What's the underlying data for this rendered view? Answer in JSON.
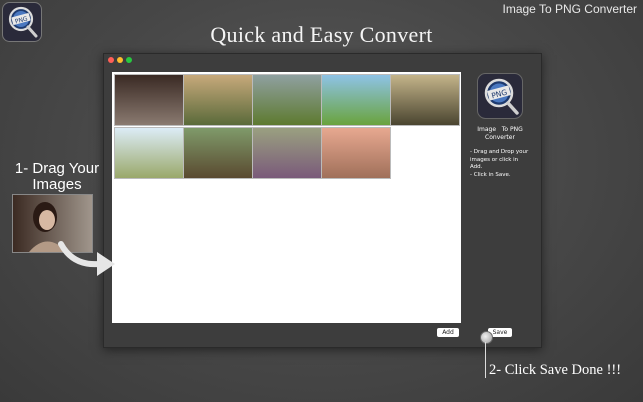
{
  "app_title": "Image To PNG Converter",
  "app_icon": "png-magnifier-icon",
  "headline": "Quick and Easy Convert",
  "window": {
    "traffic_lights": [
      "close",
      "minimize",
      "zoom"
    ],
    "thumbnails": [
      {
        "name": "woman-portrait",
        "top": "#3a2a24",
        "bottom": "#8a7a70"
      },
      {
        "name": "girl-on-hill",
        "top": "#c7a97b",
        "bottom": "#5a6a3a"
      },
      {
        "name": "child-in-field",
        "top": "#8fa0a0",
        "bottom": "#5e7a2f"
      },
      {
        "name": "balloons-field",
        "top": "#8ec3e6",
        "bottom": "#6aa33d"
      },
      {
        "name": "woman-in-dress",
        "top": "#c4b48a",
        "bottom": "#4a4530"
      },
      {
        "name": "red-hat-girl",
        "top": "#dcecf6",
        "bottom": "#9aa86a"
      },
      {
        "name": "girl-with-teddy",
        "top": "#7f9a6a",
        "bottom": "#5a4a30"
      },
      {
        "name": "dogs-in-flowers",
        "top": "#9aa080",
        "bottom": "#7a5a7a"
      },
      {
        "name": "road-sunset",
        "top": "#e7a890",
        "bottom": "#a0705a"
      }
    ],
    "add_label": "Add"
  },
  "sidebar": {
    "icon": "png-magnifier-icon",
    "app_name_line1": "Image   To PNG",
    "app_name_line2": "Converter",
    "instructions": [
      "- Drag and Drop your",
      "images or click in",
      "Add.",
      "- Click in Save."
    ]
  },
  "save_label": "Save",
  "step1_line1": "1- Drag Your",
  "step1_line2": "Images",
  "step2": "2- Click Save Done !!!",
  "colors": {
    "background": "#474747",
    "window": "#3d3d3d",
    "canvas": "#ffffff",
    "close": "#ff5f57",
    "minimize": "#febc2e",
    "zoom": "#28c840"
  }
}
